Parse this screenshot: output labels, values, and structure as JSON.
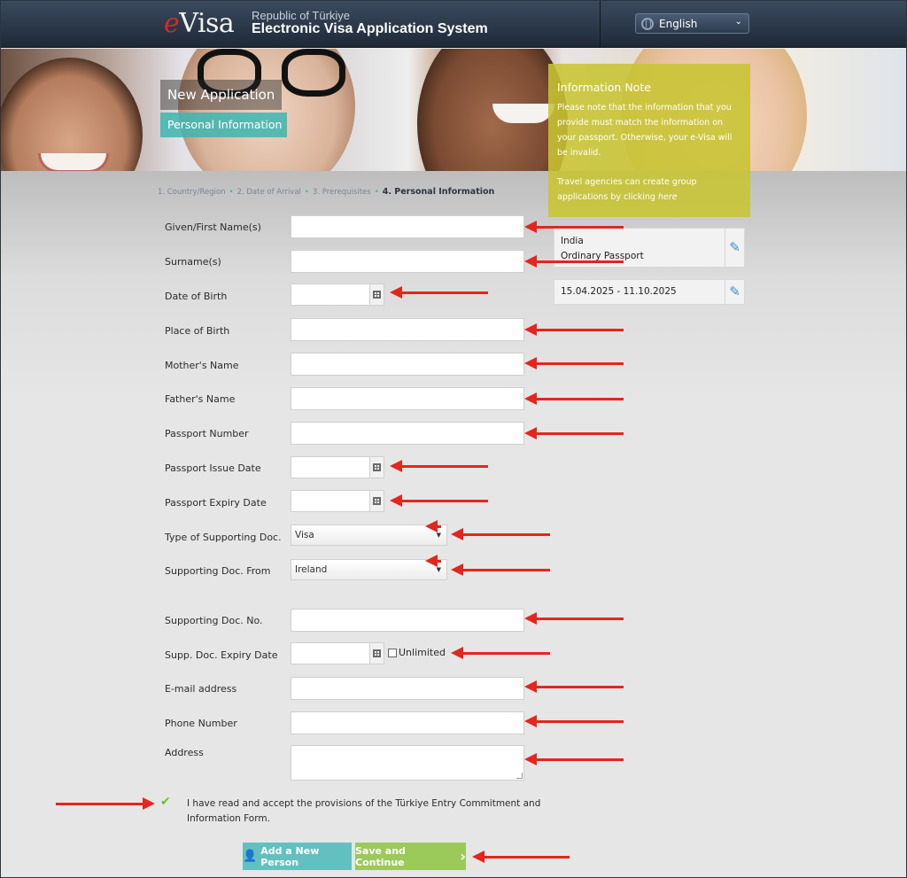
{
  "header": {
    "logo_e": "e",
    "logo_rest": "Visa",
    "subtitle": "Republic of Türkiye",
    "title": "Electronic Visa Application System",
    "language": "English"
  },
  "banner": {
    "new_application": "New Application",
    "personal_information": "Personal Information"
  },
  "info_note": {
    "title": "Information Note",
    "text1": "Please note that the information that you provide must match the information on your passport. Otherwise, your e-Visa will be invalid.",
    "text2_prefix": "Travel agencies can create group applications by clicking ",
    "text2_link": "here"
  },
  "steps": {
    "step1": "1. Country/Region",
    "step2": "2. Date of Arrival",
    "step3": "3. Prerequisites",
    "step4": "4. Personal Information",
    "sep": "•"
  },
  "summary": {
    "country": "India",
    "passport_type": "Ordinary Passport",
    "dates": "15.04.2025 - 11.10.2025"
  },
  "form": {
    "given_name": "Given/First Name(s)",
    "surname": "Surname(s)",
    "date_of_birth": "Date of Birth",
    "place_of_birth": "Place of Birth",
    "mothers_name": "Mother's Name",
    "fathers_name": "Father's Name",
    "passport_number": "Passport Number",
    "passport_issue_date": "Passport Issue Date",
    "passport_expiry_date": "Passport Expiry Date",
    "type_of_supporting_doc": "Type of Supporting Doc.",
    "type_of_supporting_doc_value": "Visa",
    "supporting_doc_from": "Supporting Doc. From",
    "supporting_doc_from_value": "Ireland",
    "supporting_doc_no": "Supporting Doc. No.",
    "supp_doc_expiry_date": "Supp. Doc. Expiry Date",
    "unlimited": "Unlimited",
    "email": "E-mail address",
    "phone": "Phone Number",
    "address": "Address"
  },
  "accept_text": "I have read and accept the provisions of the Türkiye Entry Commitment and Information Form.",
  "buttons": {
    "add_new_person": "Add a New Person",
    "save_and_continue": "Save and Continue"
  },
  "colors": {
    "annotation_arrow": "#e3261e",
    "teal": "#62c0c0",
    "green": "#9bc95a",
    "info_note": "#c8c432"
  },
  "icons": [
    "globe-icon",
    "chevron-down-icon",
    "calendar-icon",
    "pencil-icon",
    "check-icon",
    "person-icon",
    "chevron-right-icon",
    "arrow-annotation-icon"
  ]
}
